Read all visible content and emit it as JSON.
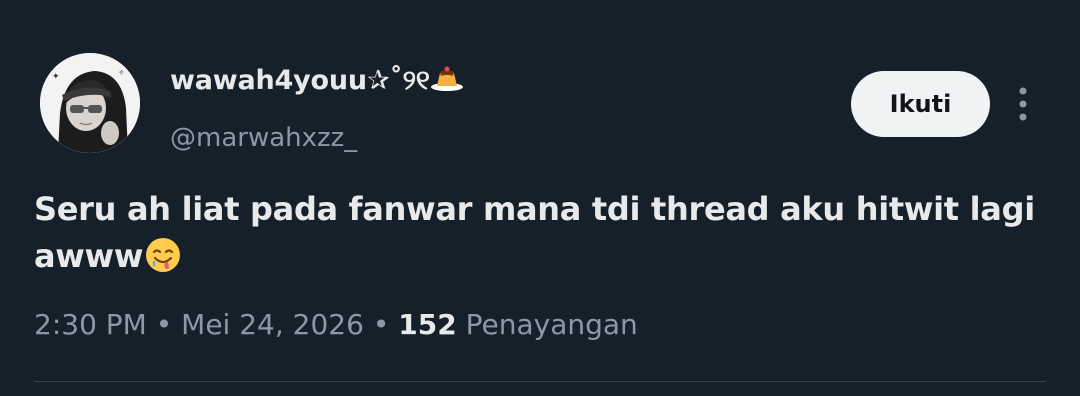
{
  "user": {
    "display_name_text": "wawah4youu",
    "display_name_decoration": "✰˚୨୧",
    "username": "@marwahxzz_",
    "avatar_icon": "user-avatar-photo"
  },
  "actions": {
    "follow_label": "Ikuti",
    "more_icon": "more-vertical-icon"
  },
  "tweet": {
    "text": "Seru ah liat pada fanwar mana tdi thread aku hitwit lagi awww",
    "emoji_icon": "drooling-face-emoji"
  },
  "meta": {
    "time": "2:30 PM",
    "separator1": " • ",
    "date": "Mei 24, 2026",
    "separator2": " • ",
    "views_count": "152",
    "views_label": " Penayangan"
  },
  "colors": {
    "background": "#15202b",
    "text_primary": "#e7e9ea",
    "text_secondary": "#8b98a5",
    "button_bg": "#eff3f4",
    "divider": "#38444d"
  }
}
